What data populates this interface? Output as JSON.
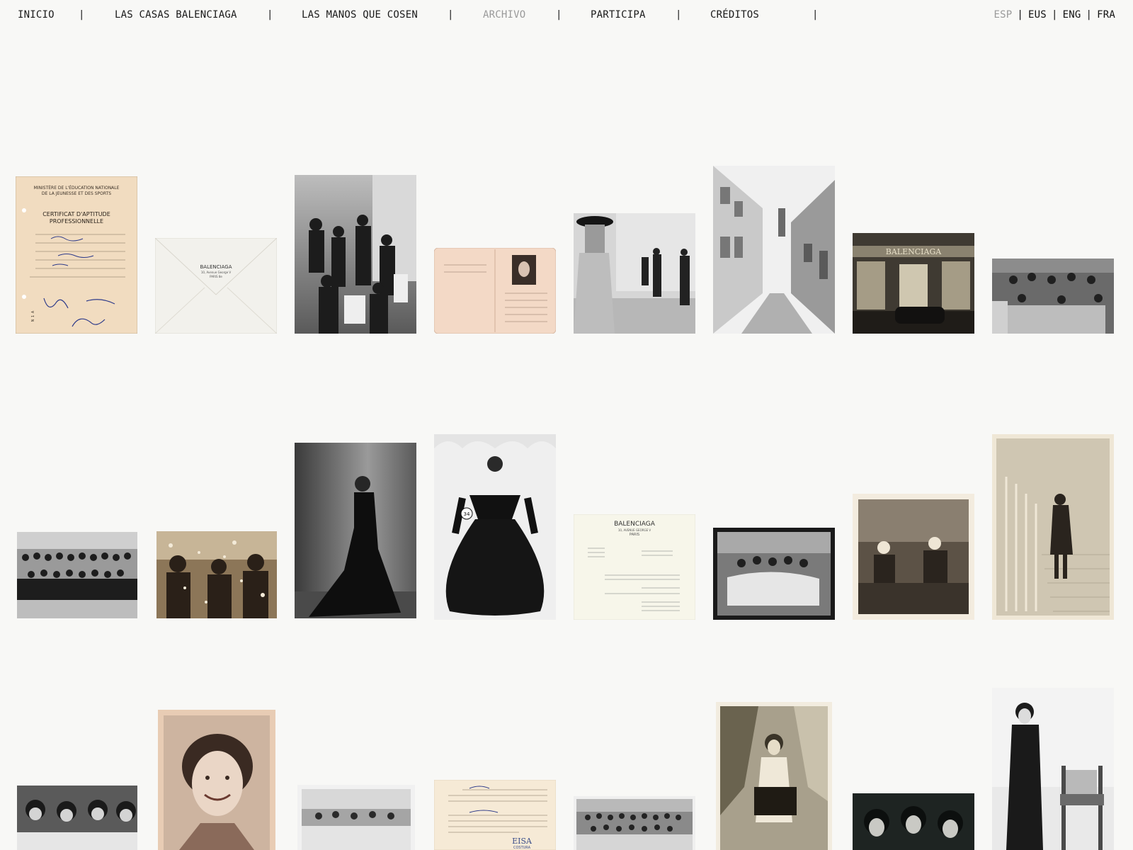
{
  "nav": {
    "items": [
      {
        "label": "INICIO",
        "active": false
      },
      {
        "label": "LAS CASAS BALENCIAGA",
        "active": false
      },
      {
        "label": "LAS MANOS QUE COSEN",
        "active": false
      },
      {
        "label": "ARCHIVO",
        "active": true
      },
      {
        "label": "PARTICIPA",
        "active": false
      },
      {
        "label": "CRÉDITOS",
        "active": false
      }
    ],
    "separator": "|",
    "languages": [
      {
        "label": "ESP",
        "active": true
      },
      {
        "label": "EUS",
        "active": false
      },
      {
        "label": "ENG",
        "active": false
      },
      {
        "label": "FRA",
        "active": false
      }
    ]
  },
  "archive": {
    "row1": [
      {
        "kind": "certificate-document",
        "heading_1": "MINISTÈRE DE L'ÉDUCATION NATIONALE",
        "heading_2": "DE LA JEUNESSE ET DES SPORTS",
        "title_1": "CERTIFICAT D'APTITUDE",
        "title_2": "PROFESSIONNELLE"
      },
      {
        "kind": "envelope",
        "brand": "BALENCIAGA",
        "address_1": "10, Avenue George V",
        "address_2": "PARIS 8e"
      },
      {
        "kind": "bw-photo-crowd"
      },
      {
        "kind": "id-booklet"
      },
      {
        "kind": "bw-photo-fashion-show"
      },
      {
        "kind": "bw-photo-street"
      },
      {
        "kind": "sepia-photo-storefront",
        "sign": "BALENCIAGA"
      },
      {
        "kind": "bw-photo-workshop"
      }
    ],
    "row2": [
      {
        "kind": "bw-photo-group"
      },
      {
        "kind": "sepia-photo-celebration"
      },
      {
        "kind": "bw-photo-gown-profile"
      },
      {
        "kind": "bw-photo-model-gown",
        "tag": "34"
      },
      {
        "kind": "letter-document",
        "brand": "BALENCIAGA",
        "address_1": "10, AVENUE GEORGE V",
        "address_2": "PARIS"
      },
      {
        "kind": "bw-photo-seamstresses"
      },
      {
        "kind": "sepia-photo-sewing"
      },
      {
        "kind": "sepia-photo-staircase"
      }
    ],
    "row3": [
      {
        "kind": "bw-photo-group-close"
      },
      {
        "kind": "sepia-portrait-smile"
      },
      {
        "kind": "bw-photo-atelier"
      },
      {
        "kind": "certificate-eisa",
        "stamp": "EISA",
        "stamp_sub": "COSTURA"
      },
      {
        "kind": "bw-photo-workroom"
      },
      {
        "kind": "sepia-photo-woman-garden"
      },
      {
        "kind": "bw-photo-three-women"
      },
      {
        "kind": "bw-photo-woman-chair"
      }
    ]
  }
}
